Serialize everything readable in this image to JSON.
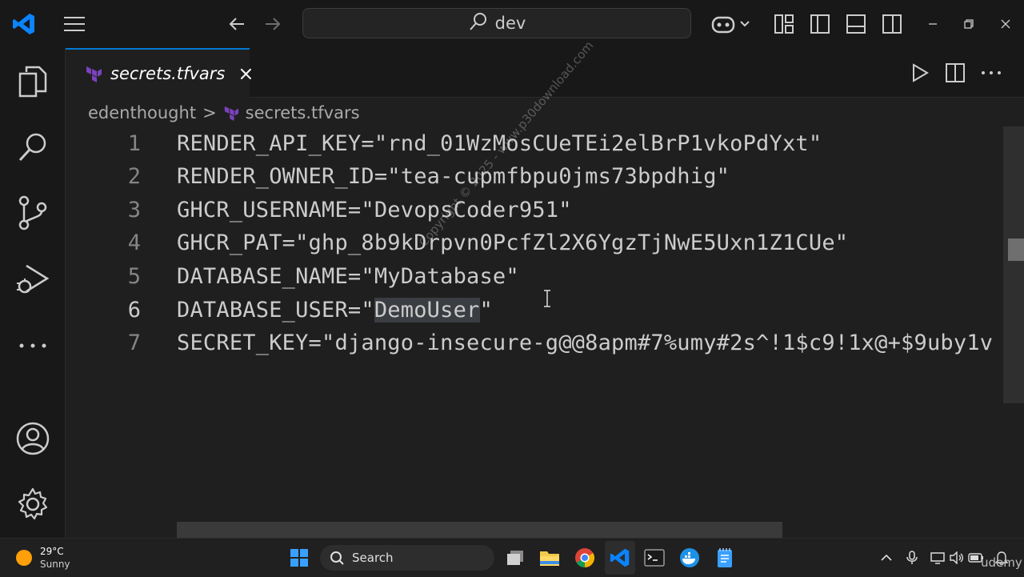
{
  "titlebar": {
    "search_text": "dev",
    "back_label": "Go Back",
    "forward_label": "Go Forward",
    "copilot_label": "Copilot"
  },
  "tab": {
    "filename": "secrets.tfvars",
    "close": "×"
  },
  "breadcrumb": {
    "folder": "edenthought",
    "separator": ">",
    "file": "secrets.tfvars"
  },
  "editor": {
    "active_line": 6,
    "lines": [
      {
        "num": "1",
        "text": "RENDER_API_KEY=\"rnd_01WzMosCUeTEi2elBrP1vkoPdYxt\""
      },
      {
        "num": "2",
        "text": "RENDER_OWNER_ID=\"tea-cupmfbpu0jms73bpdhig\""
      },
      {
        "num": "3",
        "text": "GHCR_USERNAME=\"DevopsCoder951\""
      },
      {
        "num": "4",
        "text": "GHCR_PAT=\"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\""
      },
      {
        "num": "5",
        "text": "DATABASE_NAME=\"MyDatabase\""
      },
      {
        "num": "6",
        "before": "DATABASE_USER=\"",
        "selected": "DemoUser",
        "after": "\""
      },
      {
        "num": "7",
        "text": "SECRET_KEY=\"django-insecure-g@@8apm#7%umy#2s^!1$c9!1x@+$9uby1v"
      }
    ]
  },
  "weather": {
    "temp": "29°C",
    "condition": "Sunny"
  },
  "taskbar": {
    "search_label": "Search"
  },
  "watermark": "Copyright © 2025 - www.p30download.com",
  "udemy": "udemy",
  "colors": {
    "accent": "#0078d4",
    "terraform": "#7b42bc"
  }
}
